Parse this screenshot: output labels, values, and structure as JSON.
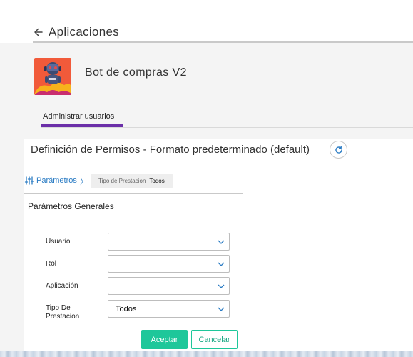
{
  "header": {
    "title": "Aplicaciones",
    "back_icon": "arrow-left-icon"
  },
  "app": {
    "name": "Bot de compras V2",
    "icon": "robot-avatar-icon"
  },
  "tabs": [
    {
      "label": "Administrar usuarios",
      "active": true
    }
  ],
  "permissions": {
    "title": "Definición de Permisos - Formato predeterminado (default)",
    "refresh_icon": "refresh-icon"
  },
  "params": {
    "link_label": "Parámetros",
    "chevron": "〉",
    "chip": {
      "key": "Tipo de Prestacion",
      "value": "Todos"
    }
  },
  "general_params": {
    "title": "Parámetros Generales",
    "fields": [
      {
        "label": "Usuario",
        "value": ""
      },
      {
        "label": "Rol",
        "value": ""
      },
      {
        "label": "Aplicación",
        "value": ""
      },
      {
        "label": "Tipo De Prestacion",
        "value": "Todos"
      }
    ],
    "accept_label": "Aceptar",
    "cancel_label": "Cancelar"
  },
  "colors": {
    "accent": "#6b2fa8",
    "link": "#2b7cc4",
    "primary_button": "#1ec79a"
  }
}
